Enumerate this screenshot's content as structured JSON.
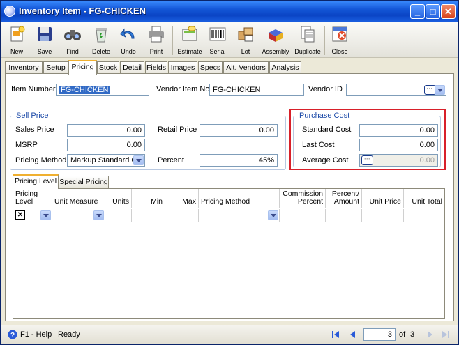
{
  "window": {
    "title": "Inventory Item - FG-CHICKEN",
    "controls": {
      "minimize": "_",
      "maximize": "□",
      "close": "✕"
    }
  },
  "toolbar": {
    "buttons": [
      {
        "label": "New",
        "icon": "new-document-icon"
      },
      {
        "label": "Save",
        "icon": "floppy-disk-icon"
      },
      {
        "label": "Find",
        "icon": "binoculars-icon"
      },
      {
        "label": "Delete",
        "icon": "recycle-bin-icon"
      },
      {
        "label": "Undo",
        "icon": "undo-arrow-icon"
      },
      {
        "label": "Print",
        "icon": "printer-icon"
      },
      {
        "label": "Estimate",
        "icon": "calculator-icon"
      },
      {
        "label": "Serial",
        "icon": "barcode-icon"
      },
      {
        "label": "Lot",
        "icon": "boxes-icon"
      },
      {
        "label": "Assembly",
        "icon": "assembly-blocks-icon"
      },
      {
        "label": "Duplicate",
        "icon": "duplicate-pages-icon"
      },
      {
        "label": "Close",
        "icon": "close-window-icon"
      }
    ]
  },
  "tabs": [
    "Inventory",
    "Setup",
    "Pricing",
    "Stock",
    "Detail",
    "Fields",
    "Images",
    "Specs",
    "Alt. Vendors",
    "Analysis"
  ],
  "active_tab": "Pricing",
  "header_fields": {
    "item_number_label": "Item Number",
    "item_number_value": "FG-CHICKEN",
    "vendor_item_no_label": "Vendor Item No",
    "vendor_item_no_value": "FG-CHICKEN",
    "vendor_id_label": "Vendor ID",
    "vendor_id_value": "",
    "ellipsis": "···"
  },
  "sell_price": {
    "title": "Sell Price",
    "sales_price_label": "Sales Price",
    "sales_price_value": "0.00",
    "msrp_label": "MSRP",
    "msrp_value": "0.00",
    "pricing_method_label": "Pricing Method",
    "pricing_method_value": "Markup Standard C",
    "retail_price_label": "Retail Price",
    "retail_price_value": "0.00",
    "percent_label": "Percent",
    "percent_value": "45%"
  },
  "purchase_cost": {
    "title": "Purchase Cost",
    "standard_cost_label": "Standard Cost",
    "standard_cost_value": "0.00",
    "last_cost_label": "Last Cost",
    "last_cost_value": "0.00",
    "average_cost_label": "Average Cost",
    "average_cost_value": "0.00",
    "ellipsis": "···"
  },
  "subtabs": [
    "Pricing Level",
    "Special Pricing"
  ],
  "grid": {
    "columns": [
      {
        "line1": "Pricing",
        "line2": "Level",
        "align": "left"
      },
      {
        "line1": "",
        "line2": "Unit Measure",
        "align": "left"
      },
      {
        "line1": "",
        "line2": "Units",
        "align": "right"
      },
      {
        "line1": "",
        "line2": "Min",
        "align": "right"
      },
      {
        "line1": "",
        "line2": "Max",
        "align": "right"
      },
      {
        "line1": "",
        "line2": "Pricing Method",
        "align": "left"
      },
      {
        "line1": "Commission",
        "line2": "Percent",
        "align": "right"
      },
      {
        "line1": "Percent/",
        "line2": "Amount",
        "align": "right"
      },
      {
        "line1": "",
        "line2": "Unit Price",
        "align": "right"
      },
      {
        "line1": "",
        "line2": "Unit Total",
        "align": "right"
      }
    ],
    "new_row_marker": "✕"
  },
  "statusbar": {
    "help": "F1 - Help",
    "status": "Ready",
    "current_page": "3",
    "of_label": "of",
    "total_pages": "3"
  },
  "colors": {
    "highlight_box": "#d8202a",
    "group_title": "#1c4aa8",
    "titlebar": "#0a44c4"
  }
}
